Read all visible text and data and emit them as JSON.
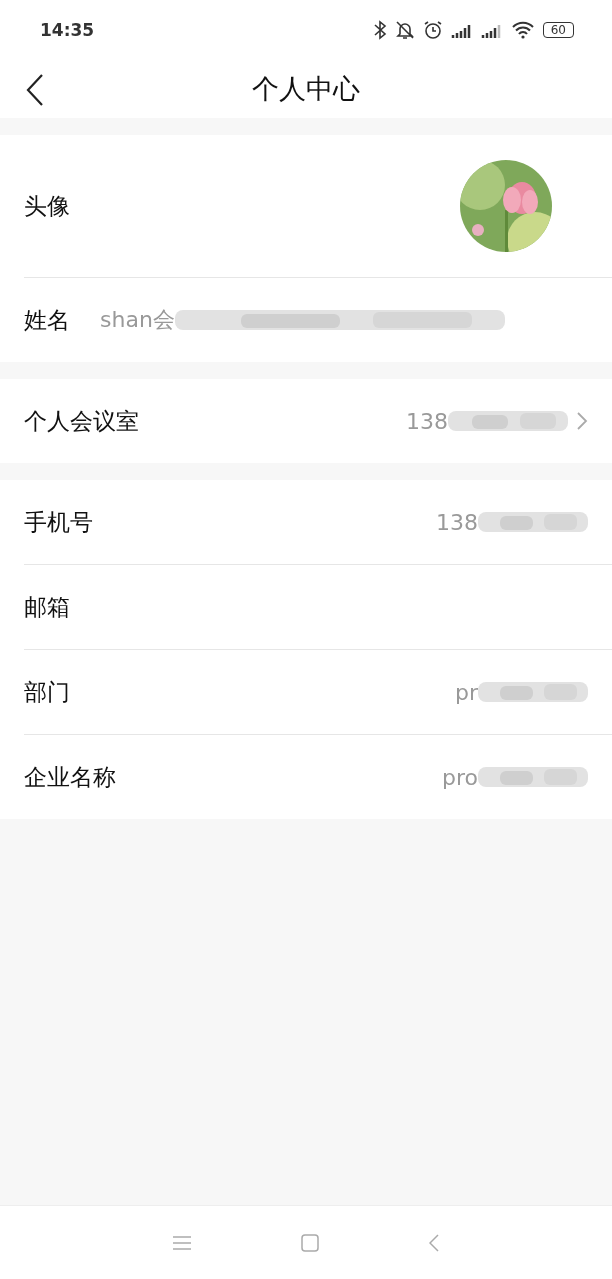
{
  "status_bar": {
    "time": "14:35",
    "battery": "60"
  },
  "header": {
    "title": "个人中心"
  },
  "sections": [
    {
      "rows": [
        {
          "kind": "avatar",
          "label": "头像",
          "arrow": false,
          "redacted": false
        },
        {
          "kind": "inline",
          "label": "姓名",
          "value": "shan会",
          "arrow": false,
          "redacted": true
        }
      ]
    },
    {
      "rows": [
        {
          "kind": "text",
          "label": "个人会议室",
          "value": "138",
          "arrow": true,
          "redacted": true
        }
      ]
    },
    {
      "rows": [
        {
          "kind": "text",
          "label": "手机号",
          "value": "138",
          "arrow": false,
          "redacted": true
        },
        {
          "kind": "text",
          "label": "邮箱",
          "arrow": false,
          "redacted": false
        },
        {
          "kind": "text",
          "label": "部门",
          "value": "pr",
          "arrow": false,
          "redacted": true
        },
        {
          "kind": "text",
          "label": "企业名称",
          "value": "pro",
          "arrow": false,
          "redacted": true
        }
      ]
    }
  ]
}
